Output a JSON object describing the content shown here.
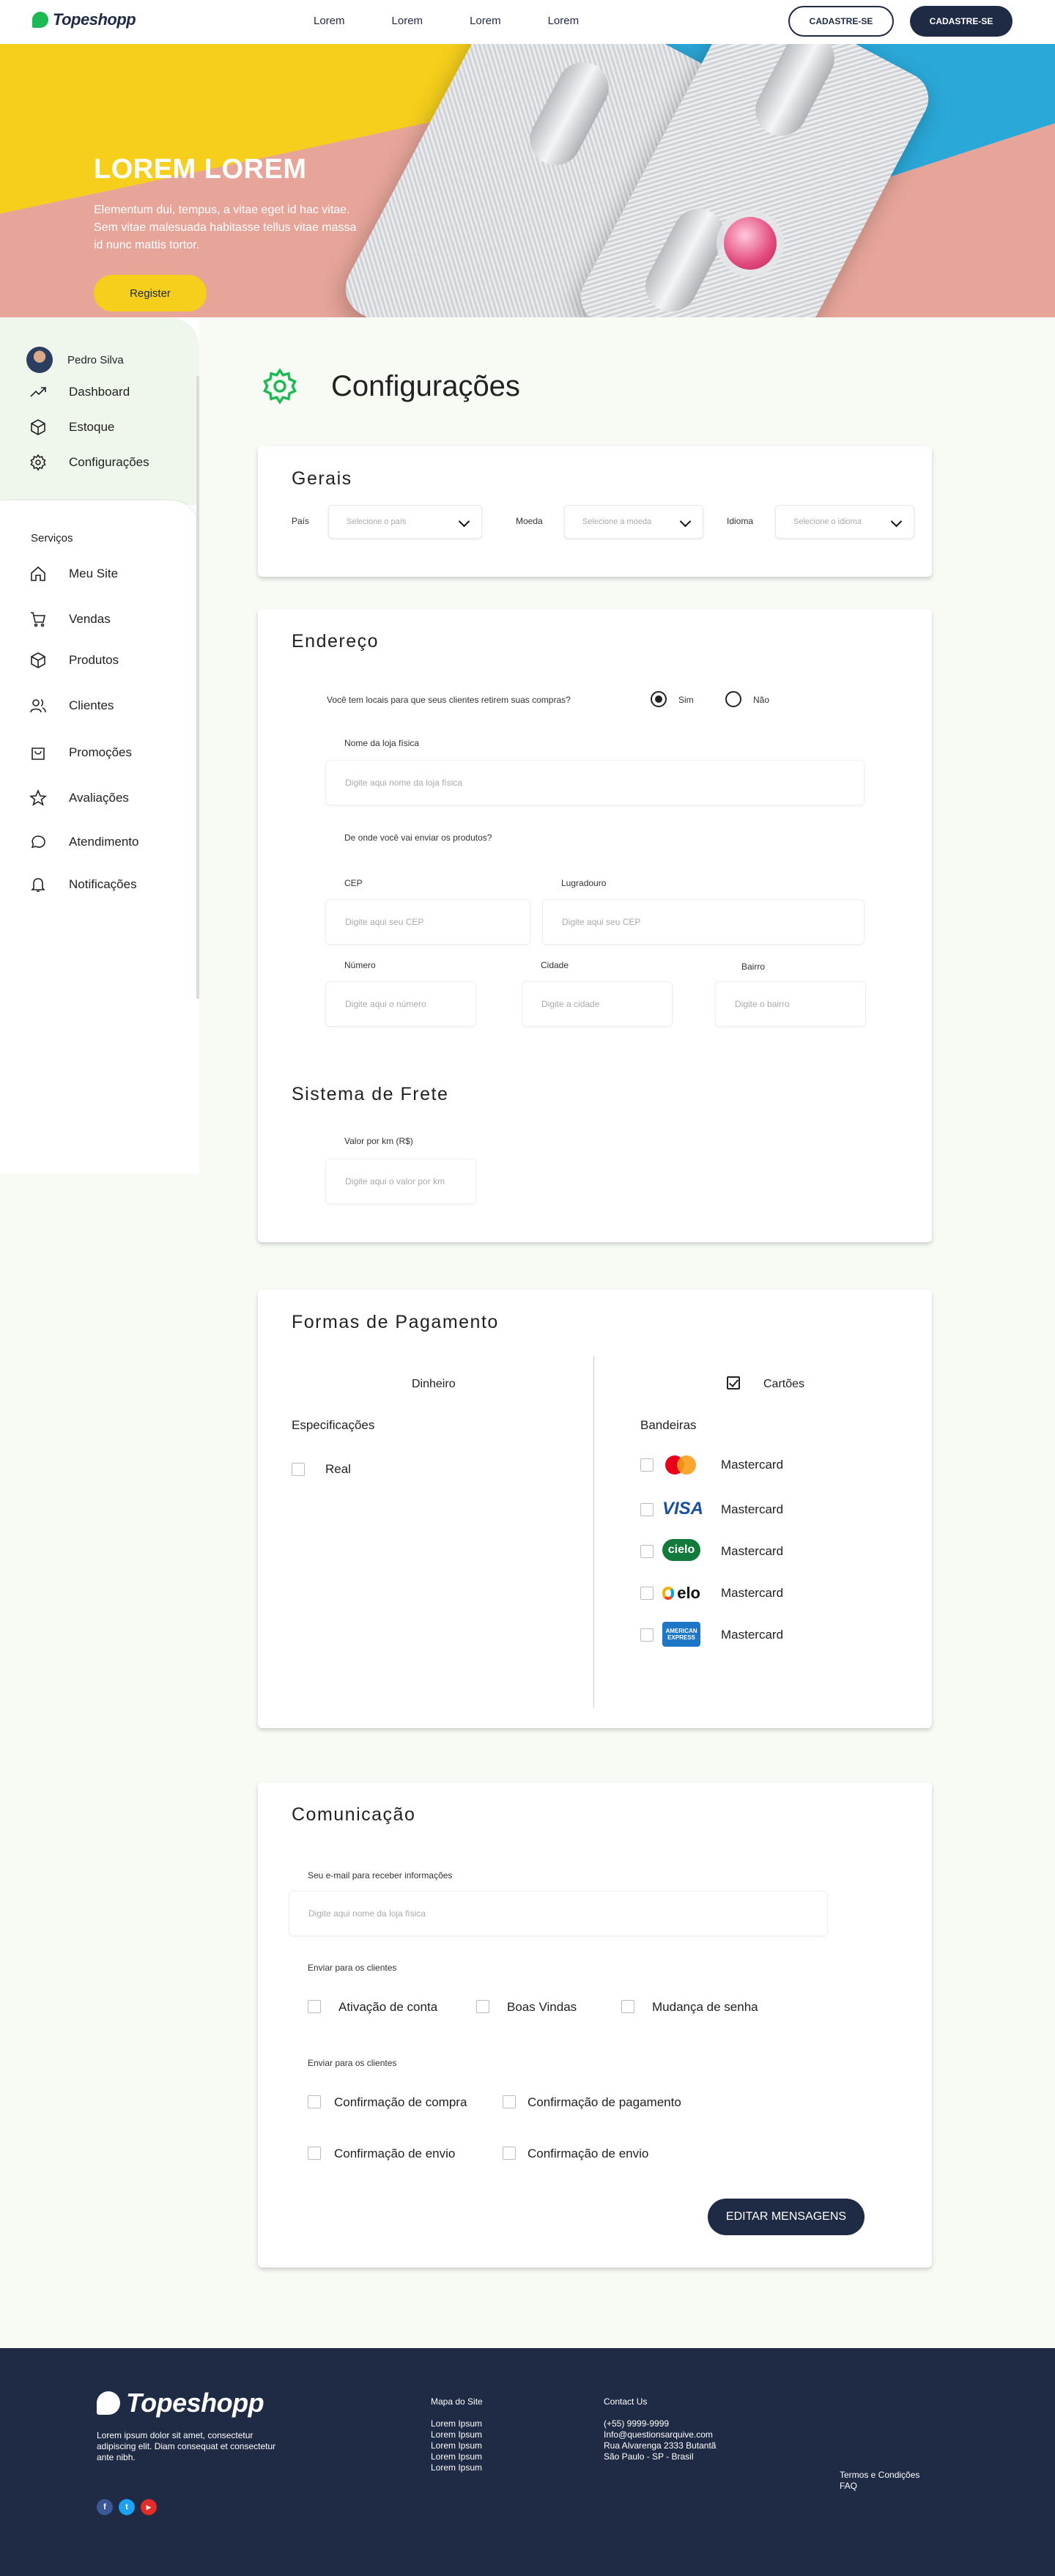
{
  "nav": {
    "brand": "Topeshopp",
    "links": [
      "Lorem",
      "Lorem",
      "Lorem",
      "Lorem"
    ],
    "btn_outline": "CADASTRE-SE",
    "btn_dark": "CADASTRE-SE"
  },
  "hero": {
    "title": "LOREM LOREM",
    "text": "Elementum dui, tempus, a vitae eget id hac vitae. Sem vitae malesuada habitasse tellus vitae massa id nunc mattis tortor.",
    "button": "Register"
  },
  "sidebar": {
    "user": "Pedro Silva",
    "items": [
      "Dashboard",
      "Estoque",
      "Configurações"
    ],
    "services_title": "Serviços",
    "services": [
      "Meu Site",
      "Vendas",
      "Produtos",
      "Clientes",
      "Promoções",
      "Avaliações",
      "Atendimento",
      "Notificações"
    ]
  },
  "page": {
    "title": "Configurações"
  },
  "gerais": {
    "title": "Gerais",
    "pais_label": "País",
    "pais_ph": "Selecione o país",
    "moeda_label": "Moeda",
    "moeda_ph": "Selecione a moeda",
    "idioma_label": "Idioma",
    "idioma_ph": "Selecione o idioma"
  },
  "endereco": {
    "title": "Endereço",
    "question": "Você tem locais para que seus clientes retirem suas compras?",
    "sim": "Sim",
    "nao": "Não",
    "loja_label": "Nome da loja física",
    "loja_ph": "Digite aqui nome da loja física",
    "envio_q": "De onde você vai enviar os produtos?",
    "cep_label": "CEP",
    "cep_ph": "Digite aqui seu CEP",
    "lograd_label": "Lugradouro",
    "lograd_ph": "Digite aqui seu CEP",
    "numero_label": "Número",
    "numero_ph": "Digite aqui o número",
    "cidade_label": "Cidade",
    "cidade_ph": "Digite a cidade",
    "bairro_label": "Bairro",
    "bairro_ph": "Digite o bairro",
    "frete_title": "Sistema de Frete",
    "valor_label": "Valor por km (R$)",
    "valor_ph": "Digite aqui o valor por km"
  },
  "pagamento": {
    "title": "Formas de Pagamento",
    "dinheiro": "Dinheiro",
    "cartoes": "Cartões",
    "specs": "Especificações",
    "real": "Real",
    "bandeiras": "Bandeiras",
    "brands": [
      {
        "icon": "mastercard-icon",
        "label": "Mastercard"
      },
      {
        "icon": "visa-icon",
        "label": "Mastercard"
      },
      {
        "icon": "cielo-icon",
        "label": "Mastercard"
      },
      {
        "icon": "elo-icon",
        "label": "Mastercard"
      },
      {
        "icon": "amex-icon",
        "label": "Mastercard"
      }
    ],
    "visa_text": "VISA",
    "cielo_text": "cielo",
    "elo_text": "elo",
    "amex_text": "AMERICAN EXPRESS"
  },
  "comunicacao": {
    "title": "Comunicação",
    "email_label": "Seu e-mail para receber informações",
    "email_ph": "Digite aqui nome da loja física",
    "send1": "Enviar para os clientes",
    "opts1": [
      "Ativação de conta",
      "Boas Vindas",
      "Mudança de senha"
    ],
    "send2": "Enviar para os clientes",
    "opts2": [
      "Confirmação de compra",
      "Confirmação de pagamento",
      "Confirmação de envio",
      "Confirmação de envio"
    ],
    "button": "EDITAR MENSAGENS"
  },
  "footer": {
    "brand": "Topeshopp",
    "desc": "Lorem ipsum dolor sit amet, consectetur adipiscing elit. Diam consequat et consectetur ante nibh.",
    "mapa_title": "Mapa do Site",
    "mapa": [
      "Lorem Ipsum",
      "Lorem Ipsum",
      "Lorem Ipsum",
      "Lorem Ipsum",
      "Lorem Ipsum"
    ],
    "contact_title": "Contact Us",
    "contact": [
      "(+55) 9999-9999",
      "Info@questionsarquive.com",
      "Rua Alvarenga 2333 Butantã",
      "São Paulo - SP - Brasil"
    ],
    "termos": "Termos e Condições",
    "faq": "FAQ",
    "social": [
      "f",
      "t",
      "▶"
    ]
  },
  "colors": {
    "brand_dark": "#1f2a44",
    "accent_green": "#1db954",
    "hero_yellow": "#f6cf1c"
  }
}
